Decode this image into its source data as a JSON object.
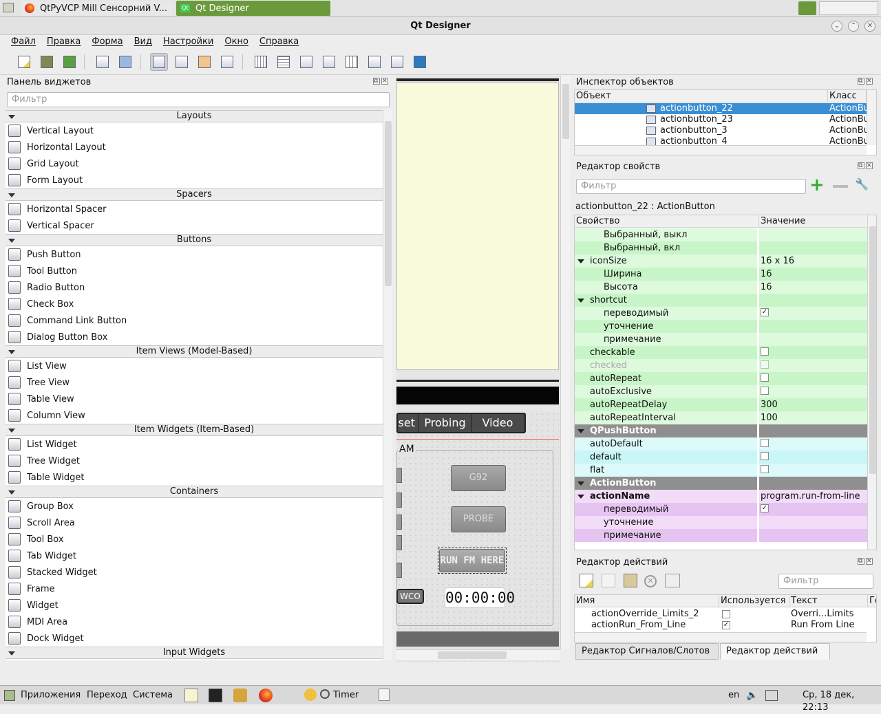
{
  "taskbar": {
    "tasks": [
      {
        "label": "QtPyVCP Mill Сенсорний V..."
      },
      {
        "label": "Qt Designer"
      }
    ]
  },
  "window": {
    "title": "Qt Designer"
  },
  "menu": [
    "Файл",
    "Правка",
    "Форма",
    "Вид",
    "Настройки",
    "Окно",
    "Справка"
  ],
  "widget_box": {
    "title": "Панель виджетов",
    "filter_placeholder": "Фильтр",
    "categories": [
      {
        "name": "Layouts",
        "items": [
          {
            "label": "Vertical Layout",
            "icon": "vertical-layout-icon"
          },
          {
            "label": "Horizontal Layout",
            "icon": "horizontal-layout-icon"
          },
          {
            "label": "Grid Layout",
            "icon": "grid-layout-icon"
          },
          {
            "label": "Form Layout",
            "icon": "form-layout-icon"
          }
        ]
      },
      {
        "name": "Spacers",
        "items": [
          {
            "label": "Horizontal Spacer",
            "icon": "horizontal-spacer-icon"
          },
          {
            "label": "Vertical Spacer",
            "icon": "vertical-spacer-icon"
          }
        ]
      },
      {
        "name": "Buttons",
        "items": [
          {
            "label": "Push Button",
            "icon": "push-button-icon"
          },
          {
            "label": "Tool Button",
            "icon": "tool-button-icon"
          },
          {
            "label": "Radio Button",
            "icon": "radio-button-icon"
          },
          {
            "label": "Check Box",
            "icon": "check-box-icon"
          },
          {
            "label": "Command Link Button",
            "icon": "command-link-icon"
          },
          {
            "label": "Dialog Button Box",
            "icon": "dialog-button-box-icon"
          }
        ]
      },
      {
        "name": "Item Views (Model-Based)",
        "items": [
          {
            "label": "List View",
            "icon": "list-view-icon"
          },
          {
            "label": "Tree View",
            "icon": "tree-view-icon"
          },
          {
            "label": "Table View",
            "icon": "table-view-icon"
          },
          {
            "label": "Column View",
            "icon": "column-view-icon"
          }
        ]
      },
      {
        "name": "Item Widgets (Item-Based)",
        "items": [
          {
            "label": "List Widget",
            "icon": "list-widget-icon"
          },
          {
            "label": "Tree Widget",
            "icon": "tree-widget-icon"
          },
          {
            "label": "Table Widget",
            "icon": "table-widget-icon"
          }
        ]
      },
      {
        "name": "Containers",
        "items": [
          {
            "label": "Group Box",
            "icon": "group-box-icon"
          },
          {
            "label": "Scroll Area",
            "icon": "scroll-area-icon"
          },
          {
            "label": "Tool Box",
            "icon": "tool-box-icon"
          },
          {
            "label": "Tab Widget",
            "icon": "tab-widget-icon"
          },
          {
            "label": "Stacked Widget",
            "icon": "stacked-widget-icon"
          },
          {
            "label": "Frame",
            "icon": "frame-icon"
          },
          {
            "label": "Widget",
            "icon": "widget-icon"
          },
          {
            "label": "MDI Area",
            "icon": "mdi-area-icon"
          },
          {
            "label": "Dock Widget",
            "icon": "dock-widget-icon"
          }
        ]
      },
      {
        "name": "Input Widgets",
        "items": []
      }
    ]
  },
  "form": {
    "tabs": [
      "set",
      "Probing",
      "Video"
    ],
    "group_title": "AM",
    "buttons": {
      "g92": "G92",
      "probe": "PROBE",
      "run": "RUN FM HERE",
      "wco": "WCO"
    },
    "timer": "00:00:00"
  },
  "object_inspector": {
    "title": "Инспектор объектов",
    "columns": [
      "Объект",
      "Класс"
    ],
    "rows": [
      {
        "name": "actionbutton_22",
        "class": "ActionBu",
        "selected": true
      },
      {
        "name": "actionbutton_23",
        "class": "ActionBu",
        "selected": false
      },
      {
        "name": "actionbutton_3",
        "class": "ActionBu",
        "selected": false
      },
      {
        "name": "actionbutton_4",
        "class": "ActionBu",
        "selected": false
      }
    ]
  },
  "property_editor": {
    "title": "Редактор свойств",
    "filter_placeholder": "Фильтр",
    "object_label": "actionbutton_22 : ActionButton",
    "columns": [
      "Свойство",
      "Значение"
    ],
    "rows": [
      {
        "name": "Выбранный, выкл",
        "value": "",
        "indent": 2,
        "style": "g2"
      },
      {
        "name": "Выбранный, вкл",
        "value": "",
        "indent": 2,
        "style": "g1"
      },
      {
        "name": "iconSize",
        "value": "16 x 16",
        "indent": 1,
        "style": "g2",
        "expand": true
      },
      {
        "name": "Ширина",
        "value": "16",
        "indent": 2,
        "style": "g1"
      },
      {
        "name": "Высота",
        "value": "16",
        "indent": 2,
        "style": "g2"
      },
      {
        "name": "shortcut",
        "value": "",
        "indent": 1,
        "style": "g1",
        "expand": true
      },
      {
        "name": "переводимый",
        "value": "",
        "indent": 2,
        "style": "g2",
        "check": "on"
      },
      {
        "name": "уточнение",
        "value": "",
        "indent": 2,
        "style": "g1"
      },
      {
        "name": "примечание",
        "value": "",
        "indent": 2,
        "style": "g2"
      },
      {
        "name": "checkable",
        "value": "",
        "indent": 1,
        "style": "g1",
        "check": "off"
      },
      {
        "name": "checked",
        "value": "",
        "indent": 1,
        "style": "g2",
        "check": "off",
        "disabled": true
      },
      {
        "name": "autoRepeat",
        "value": "",
        "indent": 1,
        "style": "g1",
        "check": "off"
      },
      {
        "name": "autoExclusive",
        "value": "",
        "indent": 1,
        "style": "g2",
        "check": "off"
      },
      {
        "name": "autoRepeatDelay",
        "value": "300",
        "indent": 1,
        "style": "g1"
      },
      {
        "name": "autoRepeatInterval",
        "value": "100",
        "indent": 1,
        "style": "g2"
      },
      {
        "name": "QPushButton",
        "value": "",
        "indent": 1,
        "style": "sec",
        "expand": true
      },
      {
        "name": "autoDefault",
        "value": "",
        "indent": 1,
        "style": "b2",
        "check": "off"
      },
      {
        "name": "default",
        "value": "",
        "indent": 1,
        "style": "b1",
        "check": "off"
      },
      {
        "name": "flat",
        "value": "",
        "indent": 1,
        "style": "b2",
        "check": "off"
      },
      {
        "name": "ActionButton",
        "value": "",
        "indent": 1,
        "style": "sec",
        "expand": true
      },
      {
        "name": "actionName",
        "value": "program.run-from-line",
        "indent": 1,
        "style": "m2",
        "expand": true,
        "bold": true
      },
      {
        "name": "переводимый",
        "value": "",
        "indent": 2,
        "style": "m1",
        "check": "on"
      },
      {
        "name": "уточнение",
        "value": "",
        "indent": 2,
        "style": "m2"
      },
      {
        "name": "примечание",
        "value": "",
        "indent": 2,
        "style": "m1"
      }
    ]
  },
  "action_editor": {
    "title": "Редактор действий",
    "filter_placeholder": "Фильтр",
    "columns": [
      "Имя",
      "Используется",
      "Текст",
      "Го"
    ],
    "rows": [
      {
        "name": "actionOverride_Limits_2",
        "used": false,
        "text": "Overri...Limits"
      },
      {
        "name": "actionRun_From_Line",
        "used": true,
        "text": "Run From Line"
      }
    ]
  },
  "bottom_tabs": [
    "Редактор Сигналов/Слотов",
    "Редактор действий"
  ],
  "system_panel": {
    "menus": [
      "Приложения",
      "Переход",
      "Система"
    ],
    "timer_label": "Timer",
    "lang": "en",
    "clock": "Ср, 18 дек, 22:13"
  },
  "colors": {
    "selection": "#3a8fd4",
    "accent_green": "#6a9a3c"
  }
}
